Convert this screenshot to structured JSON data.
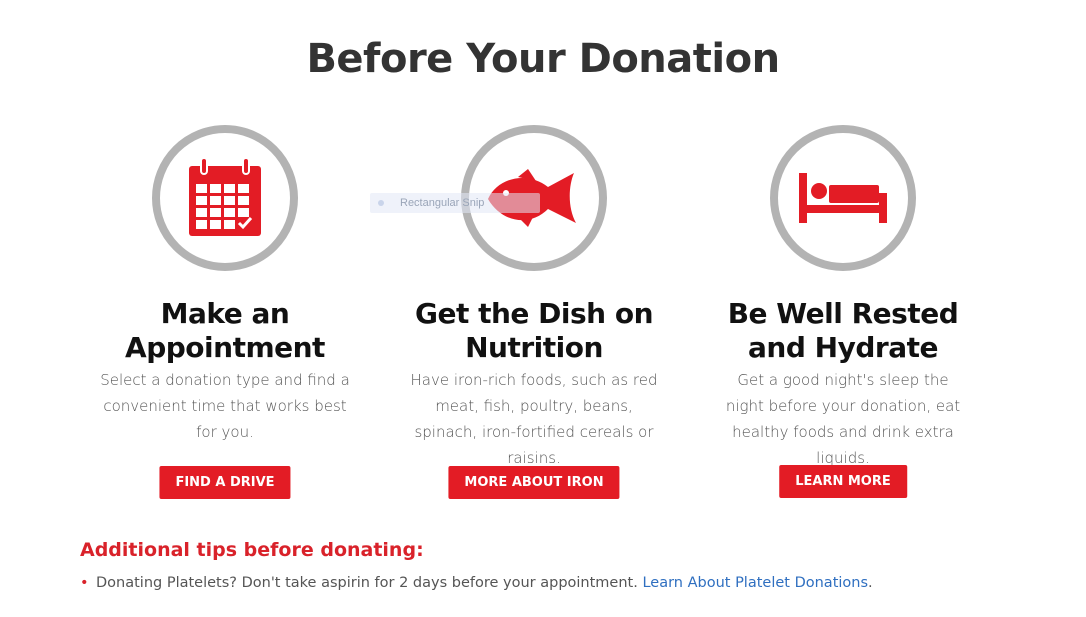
{
  "page": {
    "title": "Before Your Donation"
  },
  "columns": [
    {
      "icon": "calendar-icon",
      "title_line1": "Make an",
      "title_line2": "Appointment",
      "desc": "Select a donation type and find a convenient time that works best for you.",
      "button": "FIND A DRIVE"
    },
    {
      "icon": "fish-icon",
      "title_line1": "Get the Dish on",
      "title_line2": "Nutrition",
      "desc": "Have iron-rich foods, such as red meat, fish, poultry, beans, spinach, iron-fortified cereals or raisins.",
      "button": "MORE ABOUT IRON"
    },
    {
      "icon": "bed-icon",
      "title_line1": "Be Well Rested",
      "title_line2": "and Hydrate",
      "desc": "Get a good night's sleep the night before your donation, eat healthy foods and drink extra liquids.",
      "button": "LEARN MORE"
    }
  ],
  "overlay": {
    "ghost_label": "Rectangular Snip"
  },
  "tips": {
    "heading": "Additional tips before donating:",
    "items": [
      {
        "text": "Donating Platelets? Don't take aspirin for 2 days before your appointment. ",
        "link": "Learn About Platelet Donations",
        "trail": "."
      }
    ]
  },
  "colors": {
    "accent": "#e31c25",
    "ring": "#b3b3b3",
    "link": "#2f6fc0",
    "title": "#333333"
  }
}
